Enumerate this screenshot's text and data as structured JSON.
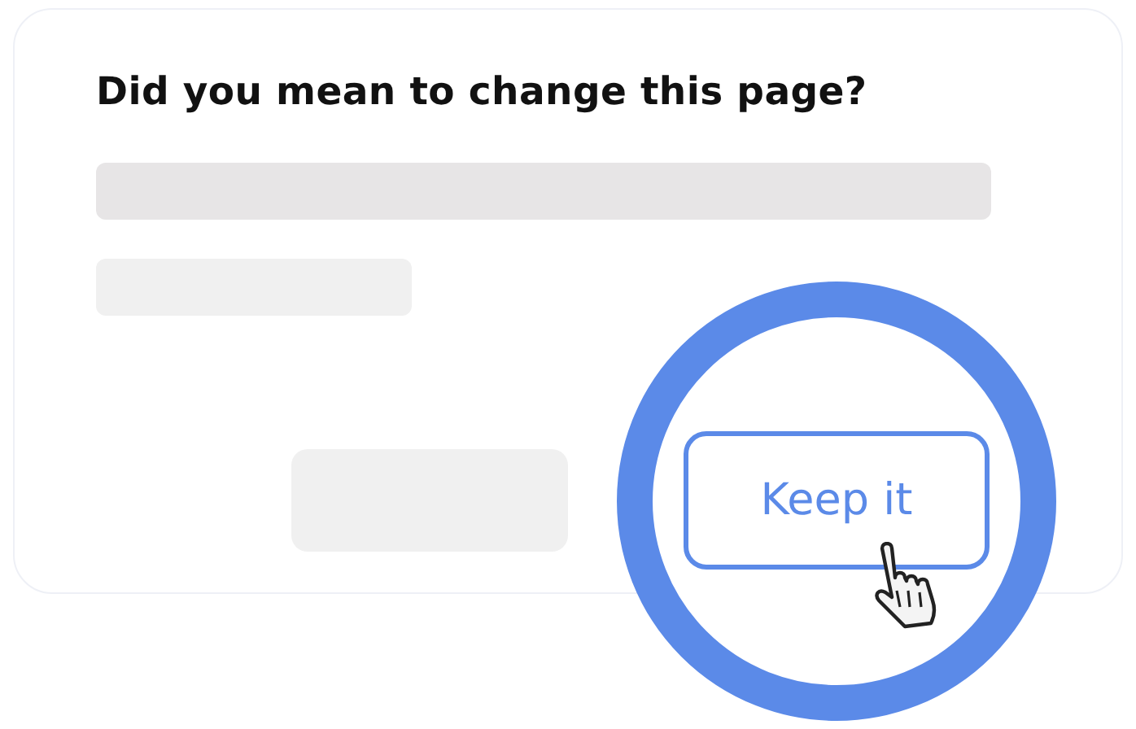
{
  "dialog": {
    "title": "Did you mean to change this page?",
    "buttons": [
      {
        "kind": "blank"
      },
      {
        "kind": "primary",
        "label": "Keep it",
        "highlighted": true
      }
    ]
  }
}
